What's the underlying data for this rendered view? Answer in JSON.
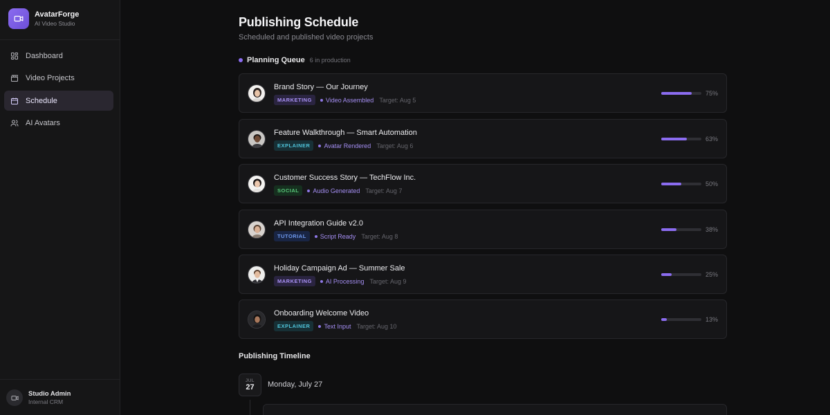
{
  "brand": {
    "name": "AvatarForge",
    "subtitle": "AI Video Studio",
    "icon": "video-camera-icon",
    "accent": "#8b6cf0"
  },
  "sidebar": {
    "items": [
      {
        "label": "Dashboard",
        "icon": "grid-icon",
        "active": false
      },
      {
        "label": "Video Projects",
        "icon": "clapperboard-icon",
        "active": false
      },
      {
        "label": "Schedule",
        "icon": "calendar-icon",
        "active": true
      },
      {
        "label": "AI Avatars",
        "icon": "users-icon",
        "active": false
      }
    ],
    "user": {
      "name": "Studio Admin",
      "role": "Internal CRM",
      "icon": "video-camera-icon"
    }
  },
  "page": {
    "title": "Publishing Schedule",
    "subtitle": "Scheduled and published video projects"
  },
  "queue": {
    "title": "Planning Queue",
    "count": "6 in production",
    "items": [
      {
        "title": "Brand Story — Our Journey",
        "tag": "MARKETING",
        "tag_type": "marketing",
        "status": "Video Assembled",
        "target": "Target: Aug 5",
        "progress": 0.75,
        "progress_label": "75%"
      },
      {
        "title": "Feature Walkthrough — Smart Automation",
        "tag": "EXPLAINER",
        "tag_type": "explainer",
        "status": "Avatar Rendered",
        "target": "Target: Aug 6",
        "progress": 0.63,
        "progress_label": "63%"
      },
      {
        "title": "Customer Success Story — TechFlow Inc.",
        "tag": "SOCIAL",
        "tag_type": "social",
        "status": "Audio Generated",
        "target": "Target: Aug 7",
        "progress": 0.5,
        "progress_label": "50%"
      },
      {
        "title": "API Integration Guide v2.0",
        "tag": "TUTORIAL",
        "tag_type": "tutorial",
        "status": "Script Ready",
        "target": "Target: Aug 8",
        "progress": 0.38,
        "progress_label": "38%"
      },
      {
        "title": "Holiday Campaign Ad — Summer Sale",
        "tag": "MARKETING",
        "tag_type": "marketing",
        "status": "AI Processing",
        "target": "Target: Aug 9",
        "progress": 0.25,
        "progress_label": "25%"
      },
      {
        "title": "Onboarding Welcome Video",
        "tag": "EXPLAINER",
        "tag_type": "explainer",
        "status": "Text Input",
        "target": "Target: Aug 10",
        "progress": 0.13,
        "progress_label": "13%"
      }
    ]
  },
  "timeline": {
    "title": "Publishing Timeline",
    "date_month": "JUL",
    "date_day": "27",
    "date_label": "Monday, July 27"
  }
}
